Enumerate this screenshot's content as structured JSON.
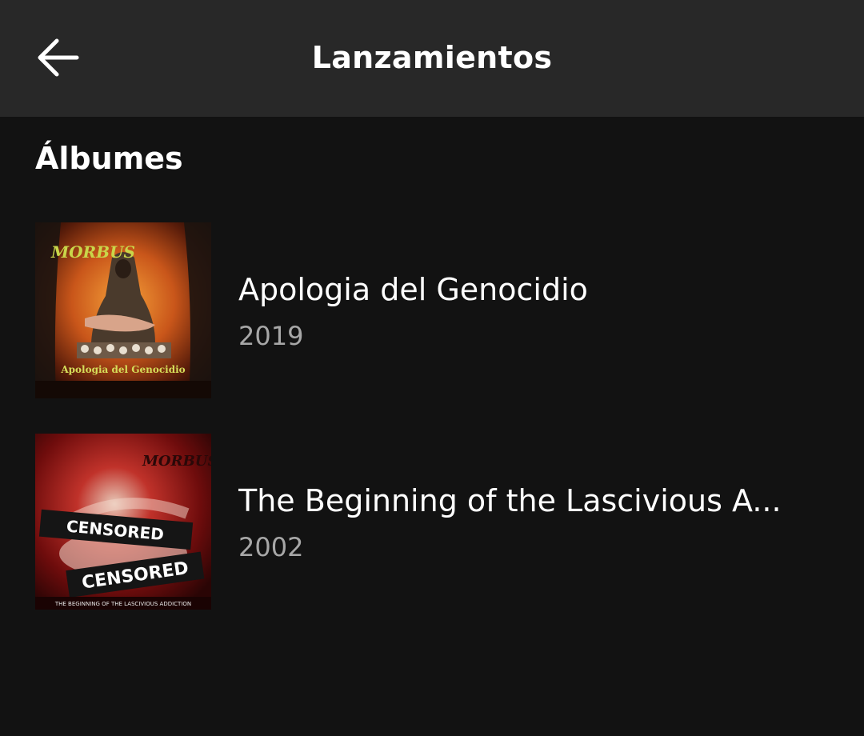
{
  "header": {
    "title": "Lanzamientos",
    "back_icon": "arrow-left-icon"
  },
  "section": {
    "title": "Álbumes"
  },
  "albums": [
    {
      "name": "Apologia del Genocidio",
      "year": "2019",
      "cover": {
        "band_logo": "MORBUS",
        "cover_title": "Apologia del Genocidio"
      }
    },
    {
      "name": "The Beginning of the Lascivious A...",
      "year": "2002",
      "cover": {
        "band_logo": "MORBUS",
        "sticker_1": "CENSORED",
        "sticker_2": "CENSORED",
        "cover_title": "THE BEGINNING OF THE LASCIVIOUS ADDICTION"
      }
    }
  ],
  "colors": {
    "background": "#121212",
    "header_bar": "#282828",
    "primary_text": "#ffffff",
    "secondary_text": "#a7a7a7"
  }
}
